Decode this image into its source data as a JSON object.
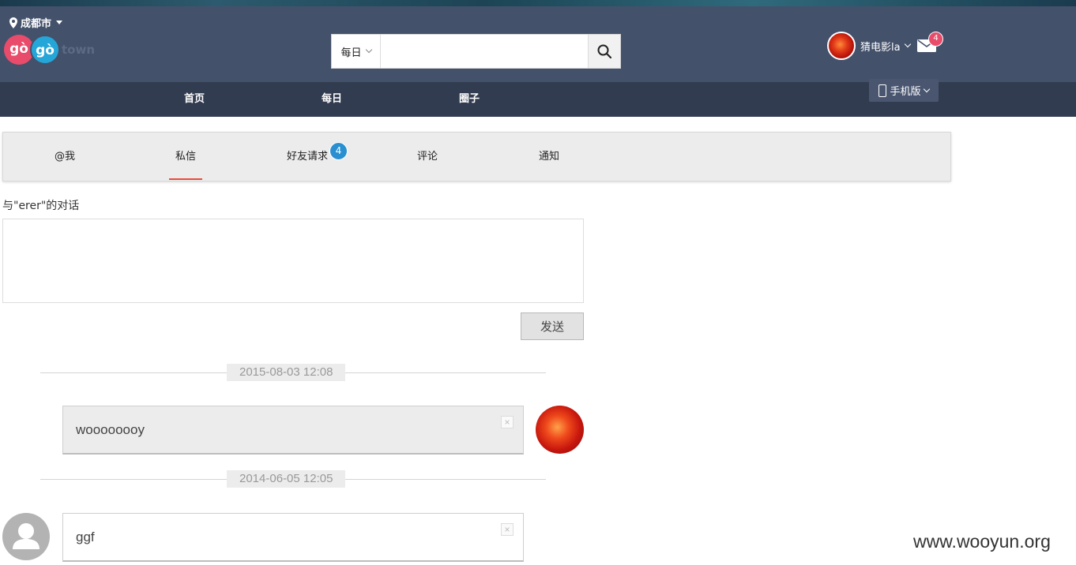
{
  "header": {
    "city": "成都市",
    "logo": {
      "go1": "gò",
      "go2": "gò",
      "town": "town"
    },
    "search": {
      "scope": "每日",
      "placeholder": "",
      "value": ""
    },
    "user": {
      "name": "猜电影la"
    },
    "mail_badge": "4",
    "mobile_label": "手机版"
  },
  "nav": {
    "items": [
      {
        "label": "首页"
      },
      {
        "label": "每日"
      },
      {
        "label": "圈子"
      }
    ]
  },
  "tabs": {
    "items": [
      {
        "label": "@我"
      },
      {
        "label": "私信"
      },
      {
        "label": "好友请求"
      },
      {
        "label": "评论"
      },
      {
        "label": "通知"
      }
    ],
    "active": "私信",
    "friend_badge": "4"
  },
  "conversation": {
    "title": "与\"erer\"的对话",
    "input_value": "",
    "send_label": "发送",
    "messages": [
      {
        "date": "2015-08-03 12:08",
        "text": "woooooooy",
        "side": "right"
      },
      {
        "date": "2014-06-05 12:05",
        "text": "ggf",
        "side": "left"
      }
    ]
  },
  "watermark": "www.wooyun.org",
  "colors": {
    "header_bg": "#44516b",
    "nav_bg": "#323c50",
    "accent_red": "#e94b3c",
    "badge_pink": "#e94b6a",
    "badge_blue": "#2a8fd0"
  }
}
